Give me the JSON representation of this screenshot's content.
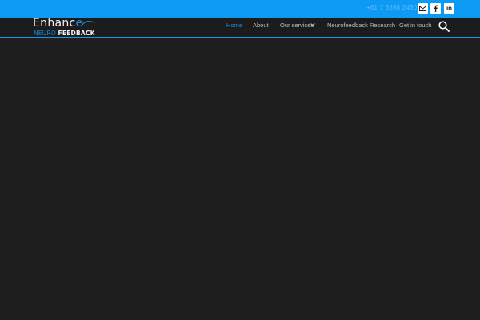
{
  "topbar": {
    "phone": "+61 7 3398 2460",
    "social": [
      {
        "icon": "email-icon"
      },
      {
        "icon": "facebook-icon"
      },
      {
        "icon": "linkedin-icon"
      }
    ]
  },
  "logo": {
    "main_a": "Enhanc",
    "main_b": "e",
    "sub_a": "NEURO",
    "sub_b": "FEEDBACK"
  },
  "nav": {
    "items": [
      {
        "label": "Home",
        "active": true
      },
      {
        "label": "About"
      },
      {
        "label": "Our services",
        "has_dropdown": true
      },
      {
        "label": "Neurofeedback Research"
      },
      {
        "label": "Get in touch"
      }
    ],
    "search_icon": "search-icon"
  },
  "colors": {
    "topbar": "#0c9af5",
    "navbar": "#1c1c1d",
    "content": "#1e1e1f",
    "accent": "#1a8be0"
  }
}
